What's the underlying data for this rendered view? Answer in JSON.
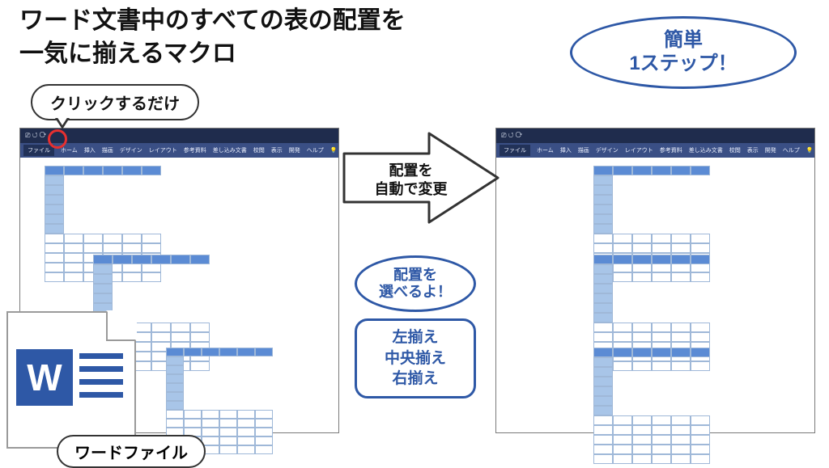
{
  "title": {
    "line1": "ワード文書中のすべての表の配置を",
    "line2": "一気に揃えるマクロ"
  },
  "easy_badge": {
    "l1": "簡単",
    "l2": "1ステップ！"
  },
  "click_bubble": "クリックするだけ",
  "arrow_label": {
    "l1": "配置を",
    "l2": "自動で変更"
  },
  "select_bubble": {
    "l1": "配置を",
    "l2": "選べるよ！"
  },
  "align_options": {
    "a": "左揃え",
    "b": "中央揃え",
    "c": "右揃え"
  },
  "file_label": "ワードファイル",
  "word_icon_letter": "W",
  "ribbon_tabs": {
    "file": "ファイル",
    "home": "ホーム",
    "insert": "挿入",
    "draw": "描画",
    "design": "デザイン",
    "layout": "レイアウト",
    "ref": "参考資料",
    "mail": "差し込み文書",
    "review": "校閲",
    "view": "表示",
    "dev": "開発",
    "help": "ヘルプ",
    "tell": "何をしますか"
  },
  "titlebar_glyphs": "⎚  ↺  ⟳"
}
